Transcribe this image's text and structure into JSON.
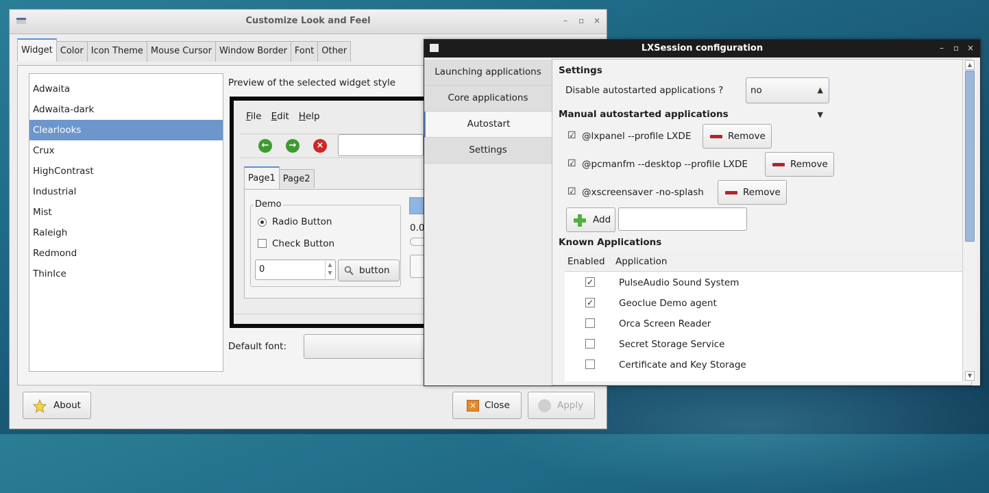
{
  "customize": {
    "title": "Customize Look and Feel",
    "tabs": [
      "Widget",
      "Color",
      "Icon Theme",
      "Mouse Cursor",
      "Window Border",
      "Font",
      "Other"
    ],
    "themes": [
      "Adwaita",
      "Adwaita-dark",
      "Clearlooks",
      "Crux",
      "HighContrast",
      "Industrial",
      "Mist",
      "Raleigh",
      "Redmond",
      "ThinIce"
    ],
    "selected_theme": "Clearlooks",
    "preview_label": "Preview of the selected widget style",
    "preview": {
      "menu": [
        "File",
        "Edit",
        "Help"
      ],
      "tabs": [
        "Page1",
        "Page2"
      ],
      "demo_label": "Demo",
      "radio_label": "Radio Button",
      "check_label": "Check Button",
      "spin_value": "0",
      "button_label": "button",
      "partial_value": "0.0"
    },
    "default_font_label": "Default font:",
    "about_label": "About",
    "close_label": "Close",
    "apply_label": "Apply"
  },
  "lxsession": {
    "title": "LXSession configuration",
    "sidebar": [
      "Launching applications",
      "Core applications",
      "Autostart",
      "Settings"
    ],
    "active_sidebar": "Autostart",
    "settings_heading": "Settings",
    "disable_label": "Disable autostarted applications ?",
    "disable_value": "no",
    "manual_heading": "Manual autostarted applications",
    "manual_items": [
      "@lxpanel --profile LXDE",
      "@pcmanfm --desktop --profile LXDE",
      "@xscreensaver -no-splash"
    ],
    "remove_label": "Remove",
    "add_label": "Add",
    "known_heading": "Known Applications",
    "columns": [
      "Enabled",
      "Application"
    ],
    "known_apps": [
      {
        "name": "PulseAudio Sound System",
        "enabled": true
      },
      {
        "name": "Geoclue Demo agent",
        "enabled": true
      },
      {
        "name": "Orca Screen Reader",
        "enabled": false
      },
      {
        "name": "Secret Storage Service",
        "enabled": false
      },
      {
        "name": "Certificate and Key Storage",
        "enabled": false
      }
    ]
  },
  "colors": {
    "selection": "#6c96cc",
    "accent_tab": "#5e90cf",
    "desktop": "#1f6a86"
  }
}
